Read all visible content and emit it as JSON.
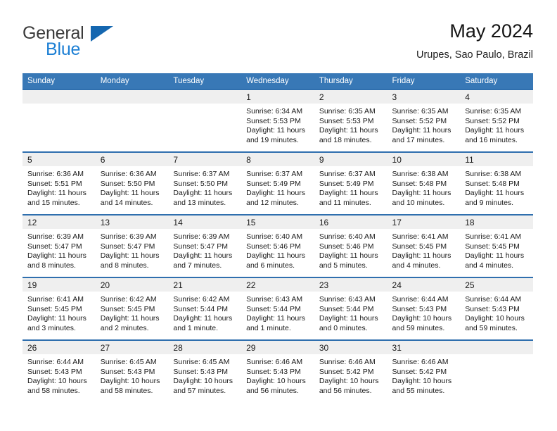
{
  "brand": {
    "name_part1": "General",
    "name_part2": "Blue",
    "logo_icon": "triangle-logo-icon"
  },
  "header": {
    "title": "May 2024",
    "location": "Urupes, Sao Paulo, Brazil"
  },
  "colors": {
    "header_blue": "#3878b6",
    "row_border_blue": "#2f6fae",
    "daynum_band_gray": "#efefef",
    "brand_blue": "#1c7fd4"
  },
  "weekday_headers": [
    "Sunday",
    "Monday",
    "Tuesday",
    "Wednesday",
    "Thursday",
    "Friday",
    "Saturday"
  ],
  "weeks": [
    [
      {
        "empty": true
      },
      {
        "empty": true
      },
      {
        "empty": true
      },
      {
        "day": "1",
        "sunrise": "Sunrise: 6:34 AM",
        "sunset": "Sunset: 5:53 PM",
        "daylight1": "Daylight: 11 hours",
        "daylight2": "and 19 minutes."
      },
      {
        "day": "2",
        "sunrise": "Sunrise: 6:35 AM",
        "sunset": "Sunset: 5:53 PM",
        "daylight1": "Daylight: 11 hours",
        "daylight2": "and 18 minutes."
      },
      {
        "day": "3",
        "sunrise": "Sunrise: 6:35 AM",
        "sunset": "Sunset: 5:52 PM",
        "daylight1": "Daylight: 11 hours",
        "daylight2": "and 17 minutes."
      },
      {
        "day": "4",
        "sunrise": "Sunrise: 6:35 AM",
        "sunset": "Sunset: 5:52 PM",
        "daylight1": "Daylight: 11 hours",
        "daylight2": "and 16 minutes."
      }
    ],
    [
      {
        "day": "5",
        "sunrise": "Sunrise: 6:36 AM",
        "sunset": "Sunset: 5:51 PM",
        "daylight1": "Daylight: 11 hours",
        "daylight2": "and 15 minutes."
      },
      {
        "day": "6",
        "sunrise": "Sunrise: 6:36 AM",
        "sunset": "Sunset: 5:50 PM",
        "daylight1": "Daylight: 11 hours",
        "daylight2": "and 14 minutes."
      },
      {
        "day": "7",
        "sunrise": "Sunrise: 6:37 AM",
        "sunset": "Sunset: 5:50 PM",
        "daylight1": "Daylight: 11 hours",
        "daylight2": "and 13 minutes."
      },
      {
        "day": "8",
        "sunrise": "Sunrise: 6:37 AM",
        "sunset": "Sunset: 5:49 PM",
        "daylight1": "Daylight: 11 hours",
        "daylight2": "and 12 minutes."
      },
      {
        "day": "9",
        "sunrise": "Sunrise: 6:37 AM",
        "sunset": "Sunset: 5:49 PM",
        "daylight1": "Daylight: 11 hours",
        "daylight2": "and 11 minutes."
      },
      {
        "day": "10",
        "sunrise": "Sunrise: 6:38 AM",
        "sunset": "Sunset: 5:48 PM",
        "daylight1": "Daylight: 11 hours",
        "daylight2": "and 10 minutes."
      },
      {
        "day": "11",
        "sunrise": "Sunrise: 6:38 AM",
        "sunset": "Sunset: 5:48 PM",
        "daylight1": "Daylight: 11 hours",
        "daylight2": "and 9 minutes."
      }
    ],
    [
      {
        "day": "12",
        "sunrise": "Sunrise: 6:39 AM",
        "sunset": "Sunset: 5:47 PM",
        "daylight1": "Daylight: 11 hours",
        "daylight2": "and 8 minutes."
      },
      {
        "day": "13",
        "sunrise": "Sunrise: 6:39 AM",
        "sunset": "Sunset: 5:47 PM",
        "daylight1": "Daylight: 11 hours",
        "daylight2": "and 8 minutes."
      },
      {
        "day": "14",
        "sunrise": "Sunrise: 6:39 AM",
        "sunset": "Sunset: 5:47 PM",
        "daylight1": "Daylight: 11 hours",
        "daylight2": "and 7 minutes."
      },
      {
        "day": "15",
        "sunrise": "Sunrise: 6:40 AM",
        "sunset": "Sunset: 5:46 PM",
        "daylight1": "Daylight: 11 hours",
        "daylight2": "and 6 minutes."
      },
      {
        "day": "16",
        "sunrise": "Sunrise: 6:40 AM",
        "sunset": "Sunset: 5:46 PM",
        "daylight1": "Daylight: 11 hours",
        "daylight2": "and 5 minutes."
      },
      {
        "day": "17",
        "sunrise": "Sunrise: 6:41 AM",
        "sunset": "Sunset: 5:45 PM",
        "daylight1": "Daylight: 11 hours",
        "daylight2": "and 4 minutes."
      },
      {
        "day": "18",
        "sunrise": "Sunrise: 6:41 AM",
        "sunset": "Sunset: 5:45 PM",
        "daylight1": "Daylight: 11 hours",
        "daylight2": "and 4 minutes."
      }
    ],
    [
      {
        "day": "19",
        "sunrise": "Sunrise: 6:41 AM",
        "sunset": "Sunset: 5:45 PM",
        "daylight1": "Daylight: 11 hours",
        "daylight2": "and 3 minutes."
      },
      {
        "day": "20",
        "sunrise": "Sunrise: 6:42 AM",
        "sunset": "Sunset: 5:45 PM",
        "daylight1": "Daylight: 11 hours",
        "daylight2": "and 2 minutes."
      },
      {
        "day": "21",
        "sunrise": "Sunrise: 6:42 AM",
        "sunset": "Sunset: 5:44 PM",
        "daylight1": "Daylight: 11 hours",
        "daylight2": "and 1 minute."
      },
      {
        "day": "22",
        "sunrise": "Sunrise: 6:43 AM",
        "sunset": "Sunset: 5:44 PM",
        "daylight1": "Daylight: 11 hours",
        "daylight2": "and 1 minute."
      },
      {
        "day": "23",
        "sunrise": "Sunrise: 6:43 AM",
        "sunset": "Sunset: 5:44 PM",
        "daylight1": "Daylight: 11 hours",
        "daylight2": "and 0 minutes."
      },
      {
        "day": "24",
        "sunrise": "Sunrise: 6:44 AM",
        "sunset": "Sunset: 5:43 PM",
        "daylight1": "Daylight: 10 hours",
        "daylight2": "and 59 minutes."
      },
      {
        "day": "25",
        "sunrise": "Sunrise: 6:44 AM",
        "sunset": "Sunset: 5:43 PM",
        "daylight1": "Daylight: 10 hours",
        "daylight2": "and 59 minutes."
      }
    ],
    [
      {
        "day": "26",
        "sunrise": "Sunrise: 6:44 AM",
        "sunset": "Sunset: 5:43 PM",
        "daylight1": "Daylight: 10 hours",
        "daylight2": "and 58 minutes."
      },
      {
        "day": "27",
        "sunrise": "Sunrise: 6:45 AM",
        "sunset": "Sunset: 5:43 PM",
        "daylight1": "Daylight: 10 hours",
        "daylight2": "and 58 minutes."
      },
      {
        "day": "28",
        "sunrise": "Sunrise: 6:45 AM",
        "sunset": "Sunset: 5:43 PM",
        "daylight1": "Daylight: 10 hours",
        "daylight2": "and 57 minutes."
      },
      {
        "day": "29",
        "sunrise": "Sunrise: 6:46 AM",
        "sunset": "Sunset: 5:43 PM",
        "daylight1": "Daylight: 10 hours",
        "daylight2": "and 56 minutes."
      },
      {
        "day": "30",
        "sunrise": "Sunrise: 6:46 AM",
        "sunset": "Sunset: 5:42 PM",
        "daylight1": "Daylight: 10 hours",
        "daylight2": "and 56 minutes."
      },
      {
        "day": "31",
        "sunrise": "Sunrise: 6:46 AM",
        "sunset": "Sunset: 5:42 PM",
        "daylight1": "Daylight: 10 hours",
        "daylight2": "and 55 minutes."
      },
      {
        "empty": true
      }
    ]
  ]
}
